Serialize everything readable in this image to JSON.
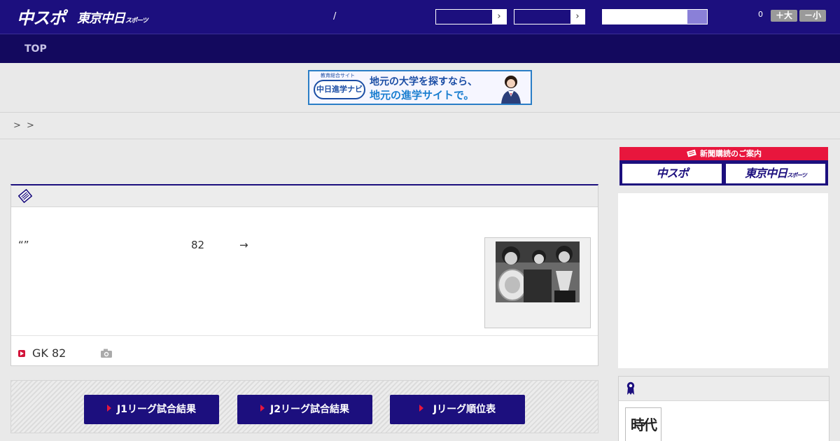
{
  "header": {
    "logo_main": "中スポ",
    "logo_sub": "東京中日",
    "logo_sub_small": "スポーツ",
    "separator": "/",
    "font_count": "0",
    "font_larger": "＋大",
    "font_smaller": "－小"
  },
  "nav": {
    "top_label": "TOP"
  },
  "banner": {
    "logo_text": "中日進学ナビ",
    "tag": "教育総合サイト",
    "line1": "地元の大学を探すなら、",
    "line2": "地元の進学サイトで。"
  },
  "breadcrumb": {
    "sep1": ">",
    "sep2": ">"
  },
  "article": {
    "quote": "“”",
    "number": "82",
    "arrow": "→",
    "footer_text": "GK 82"
  },
  "league": {
    "j1_label": "J1リーグ試合結果",
    "j2_label": "J2リーグ試合結果",
    "standings_label": "Jリーグ順位表"
  },
  "subscribe": {
    "heading": "新聞購読のご案内",
    "chuspo": "中スポ",
    "tokyo": "東京中日",
    "tokyo_small": "スポーツ"
  },
  "ranking": {
    "thumb_text": "時代"
  },
  "colors": {
    "brand": "#1c0f7e",
    "accent": "#e8163d"
  }
}
